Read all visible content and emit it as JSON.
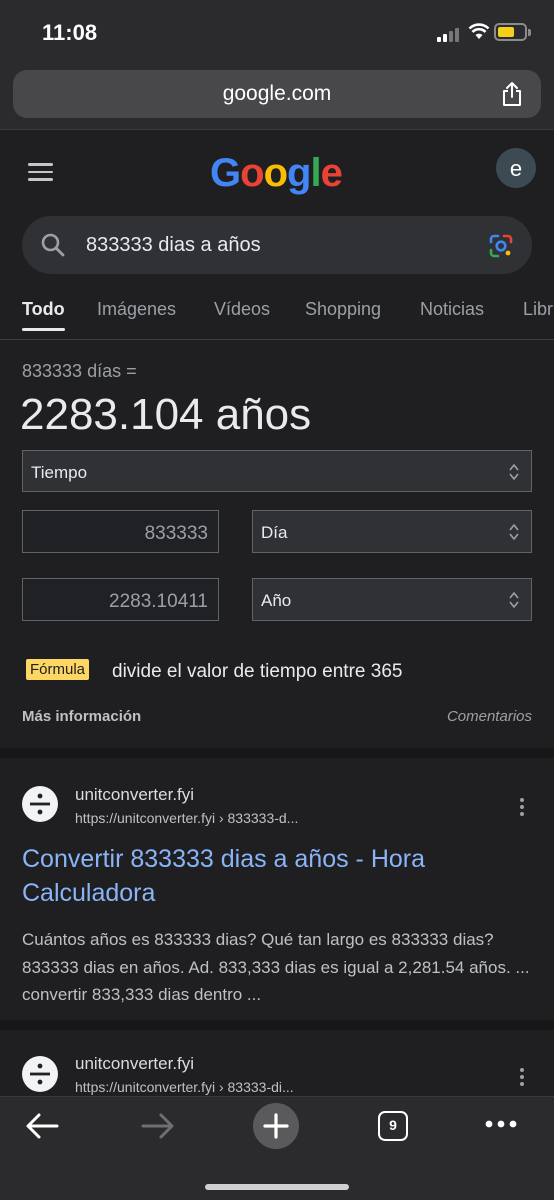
{
  "status_bar": {
    "time": "11:08"
  },
  "browser": {
    "url": "google.com"
  },
  "header": {
    "logo": [
      "G",
      "o",
      "o",
      "g",
      "l",
      "e"
    ],
    "logo_colors": [
      "#4285f4",
      "#ea4335",
      "#fbbc05",
      "#4285f4",
      "#34a853",
      "#ea4335"
    ],
    "avatar_letter": "e"
  },
  "search": {
    "query": "833333 dias a años"
  },
  "tabs": [
    {
      "label": "Todo",
      "active": true
    },
    {
      "label": "Imágenes"
    },
    {
      "label": "Vídeos"
    },
    {
      "label": "Shopping"
    },
    {
      "label": "Noticias"
    },
    {
      "label": "Libr"
    }
  ],
  "converter": {
    "summary": "833333 días =",
    "result": "2283.104 años",
    "category": "Tiempo",
    "from_value": "833333",
    "from_unit": "Día",
    "to_value": "2283.10411",
    "to_unit": "Año",
    "formula_label": "Fórmula",
    "formula_text": "divide el valor de tiempo entre 365",
    "more_info": "Más información",
    "feedback": "Comentarios"
  },
  "results": [
    {
      "site": "unitconverter.fyi",
      "url": "https://unitconverter.fyi › 833333-d...",
      "title": "Convertir 833333 dias a años - Hora Calculadora",
      "snippet": "Cuántos años es 833333 dias? Qué tan largo es 833333 dias? 833333 dias en años. Ad. 833,333 dias es igual a 2,281.54 años. ... convertir 833,333 dias dentro ..."
    },
    {
      "site": "unitconverter.fyi",
      "url": "https://unitconverter.fyi › 83333-di..."
    }
  ],
  "toolbar": {
    "tab_count": "9"
  }
}
